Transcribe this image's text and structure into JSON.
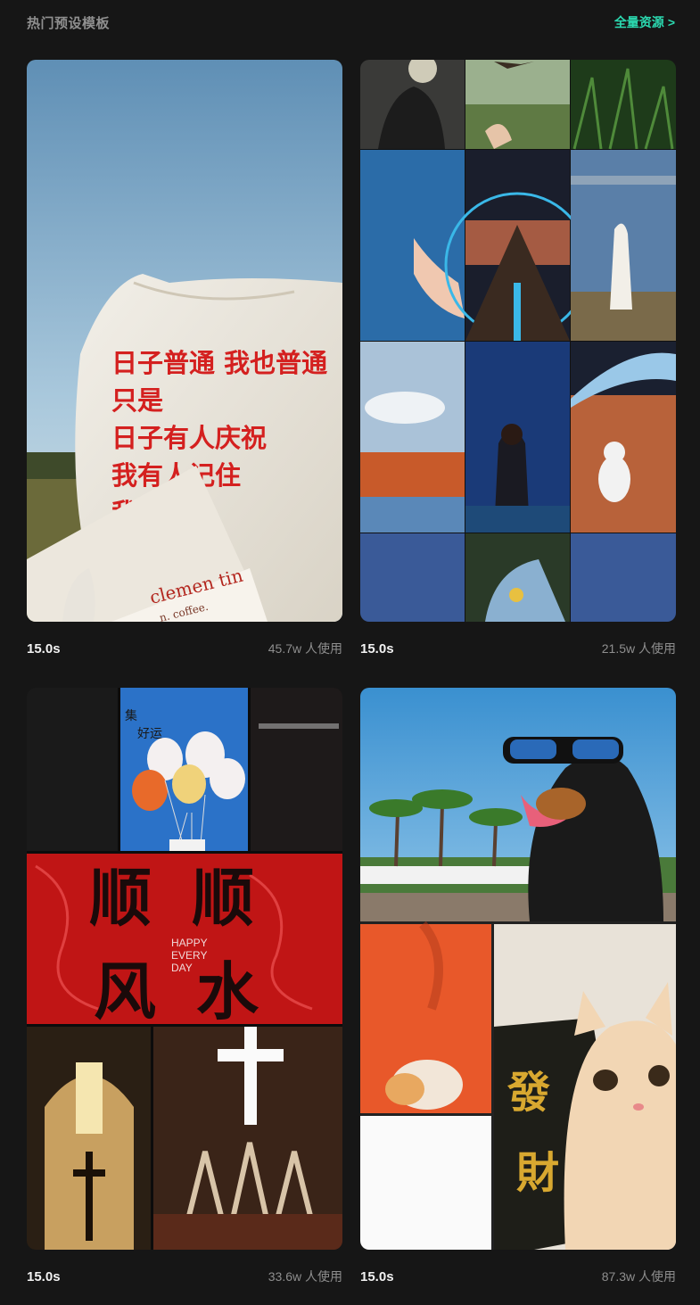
{
  "header": {
    "title": "热门预设模板",
    "all_resources_label": "全量资源",
    "chevron": ">"
  },
  "templates": [
    {
      "duration": "15.0s",
      "usage": "45.7w 人使用",
      "overlay_lines": [
        "日子普通 我也普通",
        "只是",
        "日子有人庆祝",
        "我有人记住",
        "我特别"
      ],
      "card_text": "clemen tin",
      "card_subtext": "n. coffee."
    },
    {
      "duration": "15.0s",
      "usage": "21.5w 人使用"
    },
    {
      "duration": "15.0s",
      "usage": "33.6w 人使用",
      "poster_chars": [
        "顺",
        "顺",
        "风",
        "水"
      ],
      "poster_text": [
        "HAPPY",
        "EVERY",
        "DAY"
      ],
      "balloon_caption": [
        "集",
        "好运"
      ]
    },
    {
      "duration": "15.0s",
      "usage": "87.3w 人使用",
      "charm_chars": [
        "發",
        "財"
      ]
    }
  ],
  "colors": {
    "background": "#161616",
    "accent": "#2bd9b0",
    "muted": "#8e8e8e"
  }
}
